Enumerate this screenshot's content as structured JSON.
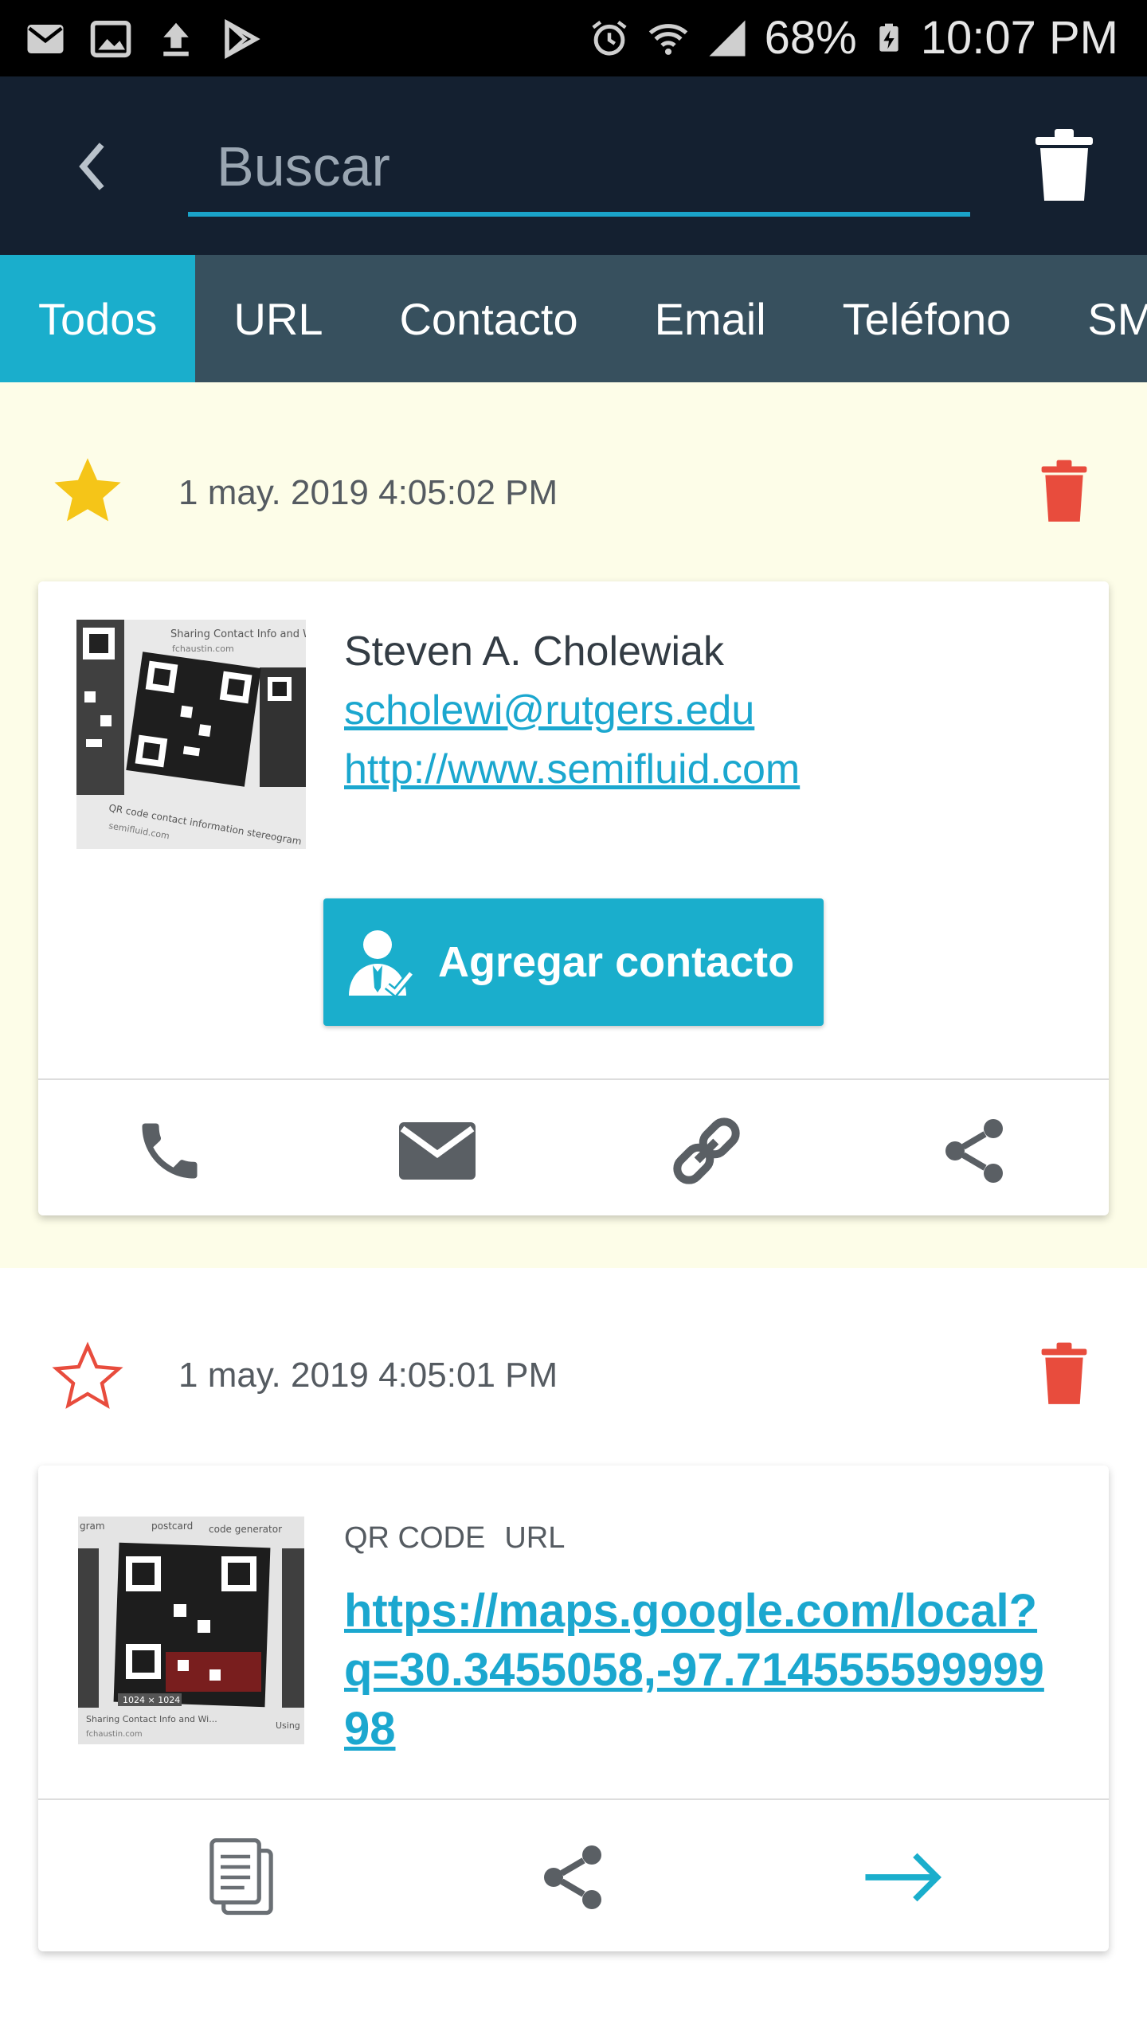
{
  "status_bar": {
    "battery": "68%",
    "time": "10:07 PM",
    "left_icons": [
      "gmail-icon",
      "gallery-icon",
      "upload-icon",
      "play-store-icon"
    ],
    "right_icons": [
      "alarm-icon",
      "wifi-icon",
      "signal-icon",
      "battery-charging-icon"
    ]
  },
  "app_bar": {
    "back_icon": "chevron-left-icon",
    "search_placeholder": "Buscar",
    "delete_all_icon": "trash-icon"
  },
  "tabs": [
    {
      "label": "Todos",
      "active": true
    },
    {
      "label": "URL",
      "active": false
    },
    {
      "label": "Contacto",
      "active": false
    },
    {
      "label": "Email",
      "active": false
    },
    {
      "label": "Teléfono",
      "active": false
    },
    {
      "label": "SMS",
      "active": false
    }
  ],
  "entries": [
    {
      "favorite": true,
      "timestamp": "1 may. 2019 4:05:02 PM",
      "background": "#fdfde8",
      "contact": {
        "name": "Steven A. Cholewiak",
        "email": "scholewi@rutgers.edu",
        "website": "http://www.semifluid.com"
      },
      "thumb_caption_top": "Sharing Contact Info and Wi",
      "thumb_caption_site": "fchaustin.com",
      "thumb_caption_bottom": "QR code contact information stereogram",
      "thumb_caption_site2": "semifluid.com",
      "add_button_label": "Agregar contacto",
      "actions": [
        "phone-icon",
        "email-icon",
        "link-icon",
        "share-icon"
      ]
    },
    {
      "favorite": false,
      "timestamp": "1 may. 2019 4:05:01 PM",
      "background": "#ffffff",
      "type_label": "QR CODE",
      "format_label": "URL",
      "url": "https://maps.google.com/local?q=30.3455058,-97.71455559999998",
      "thumb_caption_left": "gram",
      "thumb_caption_mid": "postcard",
      "thumb_caption_right": "code generator",
      "thumb_caption_size": "1024 × 1024",
      "thumb_caption_bottom": "Sharing Contact Info and Wi...",
      "thumb_caption_right2": "Using",
      "thumb_caption_site": "fchaustin.com",
      "actions": [
        "copy-icon",
        "share-icon",
        "open-arrow-icon"
      ]
    }
  ],
  "colors": {
    "accent": "#1aaecc",
    "app_bar": "#142030",
    "tab_bar": "#37505e",
    "delete_red": "#e84c3d",
    "star_gold": "#f5c518",
    "link": "#1ba7cf"
  }
}
